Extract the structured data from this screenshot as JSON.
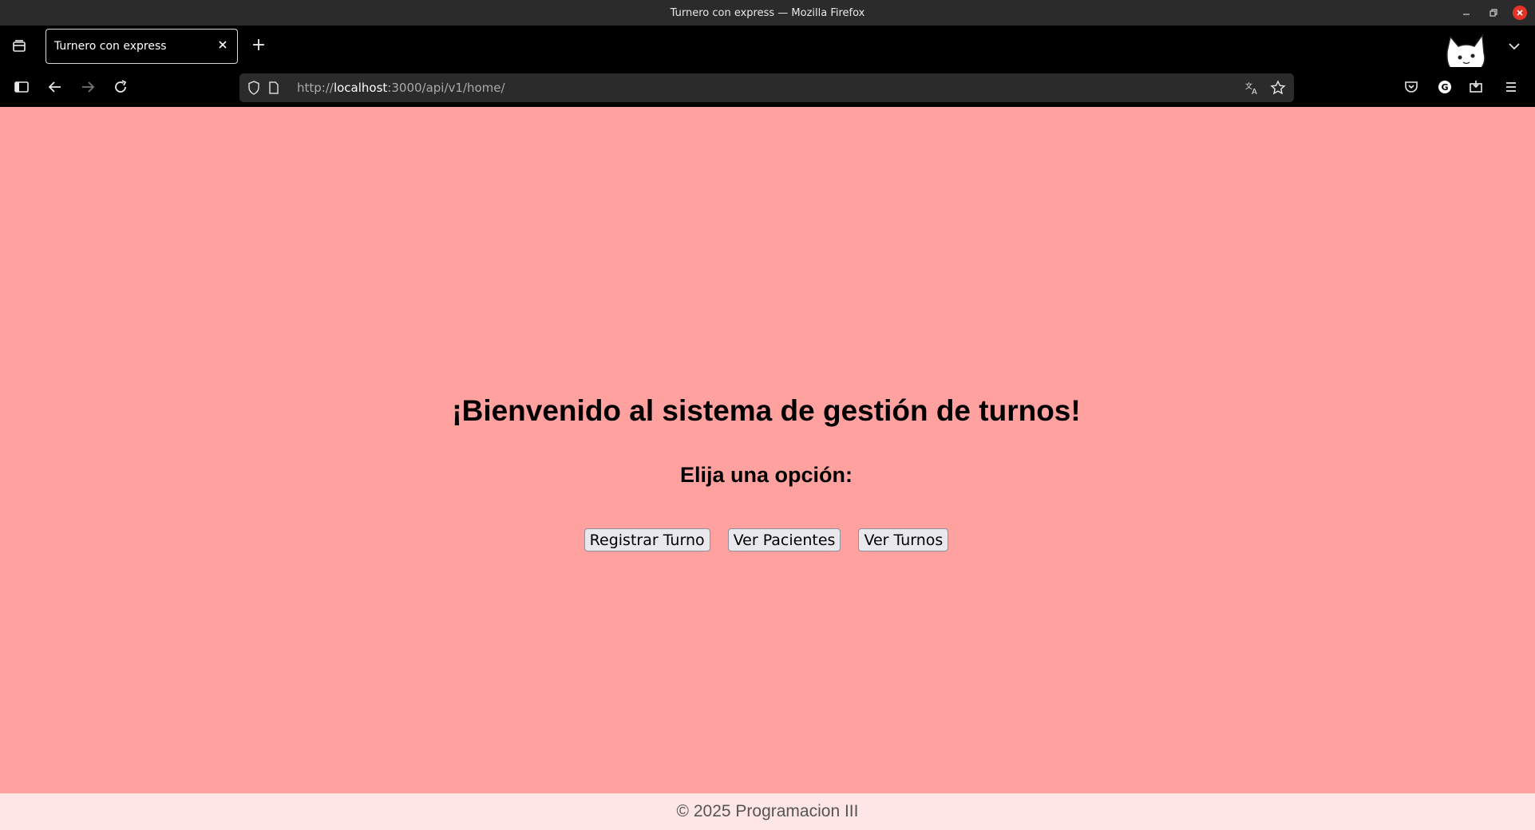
{
  "window": {
    "title": "Turnero con express — Mozilla Firefox",
    "minimize_icon": "minimize-icon",
    "maximize_icon": "restore-icon",
    "close_icon": "close-icon"
  },
  "tabs": {
    "active_tab_title": "Turnero con express",
    "new_tab_label": "+"
  },
  "navbar": {
    "url_prefix": "http://",
    "url_host": "localhost",
    "url_rest": ":3000/api/v1/home/"
  },
  "page": {
    "heading": "¡Bienvenido al sistema de gestión de turnos!",
    "subheading": "Elija una opción:",
    "buttons": [
      {
        "label": "Registrar Turno"
      },
      {
        "label": "Ver Pacientes"
      },
      {
        "label": "Ver Turnos"
      }
    ],
    "footer": "© 2025 Programacion III"
  },
  "colors": {
    "page_background": "#ffa19f",
    "footer_background": "#ffe6e6"
  }
}
